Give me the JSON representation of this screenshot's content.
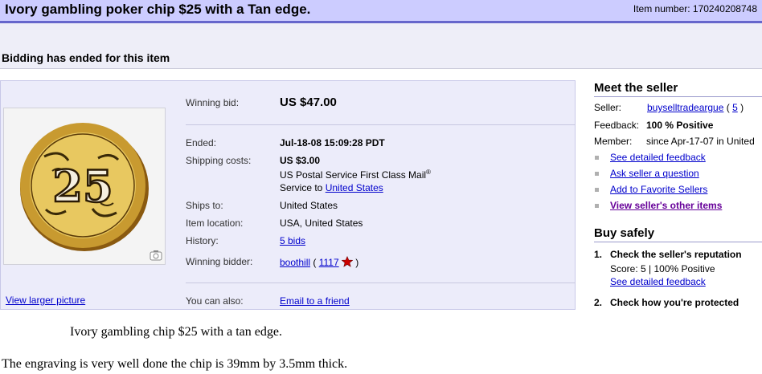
{
  "header": {
    "title": "Ivory gambling poker chip $25 with a Tan edge.",
    "item_number": "Item number: 170240208748"
  },
  "status": {
    "message": "Bidding has ended for this item"
  },
  "details": {
    "winning_bid_label": "Winning bid:",
    "winning_bid_value": "US $47.00",
    "ended_label": "Ended:",
    "ended_value": "Jul-18-08 15:09:28 PDT",
    "shipping_label": "Shipping costs:",
    "shipping_value": "US $3.00",
    "shipping_service": "US Postal Service First Class Mail",
    "shipping_service_mark": "®",
    "service_to_text": "Service to ",
    "service_to_link": "United States",
    "ships_to_label": "Ships to:",
    "ships_to_value": "United States",
    "location_label": "Item location:",
    "location_value": "USA, United States",
    "history_label": "History:",
    "history_value": "5 bids",
    "winner_label": "Winning bidder:",
    "winner_name": "boothill",
    "winner_open": " ( ",
    "winner_score": "1117",
    "winner_close": " )",
    "you_can_label": "You can also:",
    "you_can_link": "Email to a friend"
  },
  "photo": {
    "view_larger": "View larger picture",
    "chip_text": "25"
  },
  "seller": {
    "heading": "Meet the seller",
    "seller_label": "Seller:",
    "seller_name": "buyselltradeargue",
    "seller_open": " ( ",
    "seller_score": "5",
    "seller_close": " )",
    "feedback_label": "Feedback:",
    "feedback_value": "100 % Positive",
    "member_label": "Member:",
    "member_value": "since Apr-17-07 in United",
    "links": [
      "See detailed feedback",
      "Ask seller a question",
      "Add to Favorite Sellers",
      "View seller's other items"
    ]
  },
  "safety": {
    "heading": "Buy safely",
    "step1_num": "1.",
    "step1_title": "Check the seller's reputation",
    "step1_score": "Score: 5 | 100% Positive",
    "step1_link": "See detailed feedback",
    "step2_num": "2.",
    "step2_title": "Check how you're protected"
  },
  "description": {
    "line1": "Ivory gambling chip $25 with a tan edge.",
    "line2": "The engraving is very well done the chip is 39mm by 3.5mm thick."
  },
  "colors": {
    "title_bg": "#ccccff",
    "title_border": "#6666cc",
    "panel_bg": "#ececfa",
    "link": "#0000cc",
    "star": "#cc0000",
    "chip_gold": "#e8c860",
    "chip_rim": "#c8a040"
  }
}
